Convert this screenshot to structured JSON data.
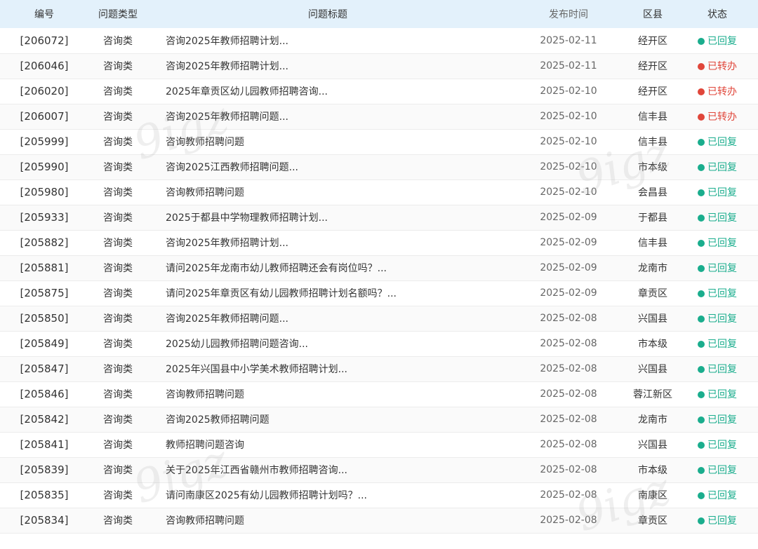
{
  "headers": {
    "id": "编号",
    "type": "问题类型",
    "title": "问题标题",
    "date": "发布时间",
    "district": "区县",
    "status": "状态"
  },
  "status_colors": {
    "已回复": "#1aad8d",
    "已转办": "#e0463a"
  },
  "rows": [
    {
      "id": "[206072]",
      "type": "咨询类",
      "title": "咨询2025年教师招聘计划...",
      "date": "2025-02-11",
      "district": "经开区",
      "status": "已回复"
    },
    {
      "id": "[206046]",
      "type": "咨询类",
      "title": "咨询2025年教师招聘计划...",
      "date": "2025-02-11",
      "district": "经开区",
      "status": "已转办"
    },
    {
      "id": "[206020]",
      "type": "咨询类",
      "title": "2025年章贡区幼儿园教师招聘咨询...",
      "date": "2025-02-10",
      "district": "经开区",
      "status": "已转办"
    },
    {
      "id": "[206007]",
      "type": "咨询类",
      "title": "咨询2025年教师招聘问题...",
      "date": "2025-02-10",
      "district": "信丰县",
      "status": "已转办"
    },
    {
      "id": "[205999]",
      "type": "咨询类",
      "title": "咨询教师招聘问题",
      "date": "2025-02-10",
      "district": "信丰县",
      "status": "已回复"
    },
    {
      "id": "[205990]",
      "type": "咨询类",
      "title": "咨询2025江西教师招聘问题...",
      "date": "2025-02-10",
      "district": "市本级",
      "status": "已回复"
    },
    {
      "id": "[205980]",
      "type": "咨询类",
      "title": "咨询教师招聘问题",
      "date": "2025-02-10",
      "district": "会昌县",
      "status": "已回复"
    },
    {
      "id": "[205933]",
      "type": "咨询类",
      "title": "2025于都县中学物理教师招聘计划...",
      "date": "2025-02-09",
      "district": "于都县",
      "status": "已回复"
    },
    {
      "id": "[205882]",
      "type": "咨询类",
      "title": "咨询2025年教师招聘计划...",
      "date": "2025-02-09",
      "district": "信丰县",
      "status": "已回复"
    },
    {
      "id": "[205881]",
      "type": "咨询类",
      "title": "请问2025年龙南市幼儿教师招聘还会有岗位吗？...",
      "date": "2025-02-09",
      "district": "龙南市",
      "status": "已回复"
    },
    {
      "id": "[205875]",
      "type": "咨询类",
      "title": "请问2025年章贡区有幼儿园教师招聘计划名额吗？...",
      "date": "2025-02-09",
      "district": "章贡区",
      "status": "已回复"
    },
    {
      "id": "[205850]",
      "type": "咨询类",
      "title": "咨询2025年教师招聘问题...",
      "date": "2025-02-08",
      "district": "兴国县",
      "status": "已回复"
    },
    {
      "id": "[205849]",
      "type": "咨询类",
      "title": "2025幼儿园教师招聘问题咨询...",
      "date": "2025-02-08",
      "district": "市本级",
      "status": "已回复"
    },
    {
      "id": "[205847]",
      "type": "咨询类",
      "title": "2025年兴国县中小学美术教师招聘计划...",
      "date": "2025-02-08",
      "district": "兴国县",
      "status": "已回复"
    },
    {
      "id": "[205846]",
      "type": "咨询类",
      "title": "咨询教师招聘问题",
      "date": "2025-02-08",
      "district": "蓉江新区",
      "status": "已回复"
    },
    {
      "id": "[205842]",
      "type": "咨询类",
      "title": "咨询2025教师招聘问题",
      "date": "2025-02-08",
      "district": "龙南市",
      "status": "已回复"
    },
    {
      "id": "[205841]",
      "type": "咨询类",
      "title": "教师招聘问题咨询",
      "date": "2025-02-08",
      "district": "兴国县",
      "status": "已回复"
    },
    {
      "id": "[205839]",
      "type": "咨询类",
      "title": "关于2025年江西省赣州市教师招聘咨询...",
      "date": "2025-02-08",
      "district": "市本级",
      "status": "已回复"
    },
    {
      "id": "[205835]",
      "type": "咨询类",
      "title": "请问南康区2025有幼儿园教师招聘计划吗？...",
      "date": "2025-02-08",
      "district": "南康区",
      "status": "已回复"
    },
    {
      "id": "[205834]",
      "type": "咨询类",
      "title": "咨询教师招聘问题",
      "date": "2025-02-08",
      "district": "章贡区",
      "status": "已回复"
    }
  ]
}
